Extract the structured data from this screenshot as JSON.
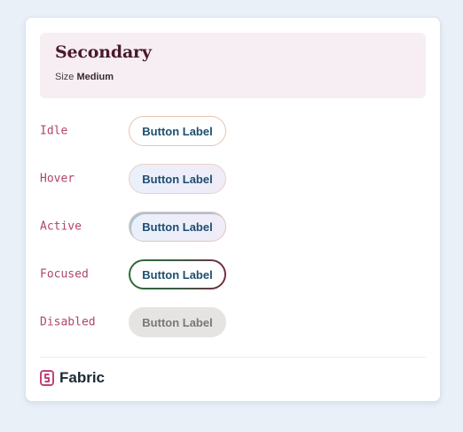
{
  "header": {
    "title": "Secondary",
    "size_label": "Size",
    "size_value": "Medium"
  },
  "states": [
    {
      "label": "Idle",
      "button_label": "Button Label"
    },
    {
      "label": "Hover",
      "button_label": "Button Label"
    },
    {
      "label": "Active",
      "button_label": "Button Label"
    },
    {
      "label": "Focused",
      "button_label": "Button Label"
    },
    {
      "label": "Disabled",
      "button_label": "Button Label"
    }
  ],
  "footer": {
    "brand": "Fabric",
    "logo_icon": "fabric-logo-icon"
  },
  "colors": {
    "background": "#eaf0f8",
    "header_bg": "#f6eef2",
    "title": "#4a1a2c",
    "state_label": "#b0456c",
    "button_text": "#1d4e70",
    "button_border": "#e8c2b0",
    "disabled_bg": "#e6e4e2"
  }
}
